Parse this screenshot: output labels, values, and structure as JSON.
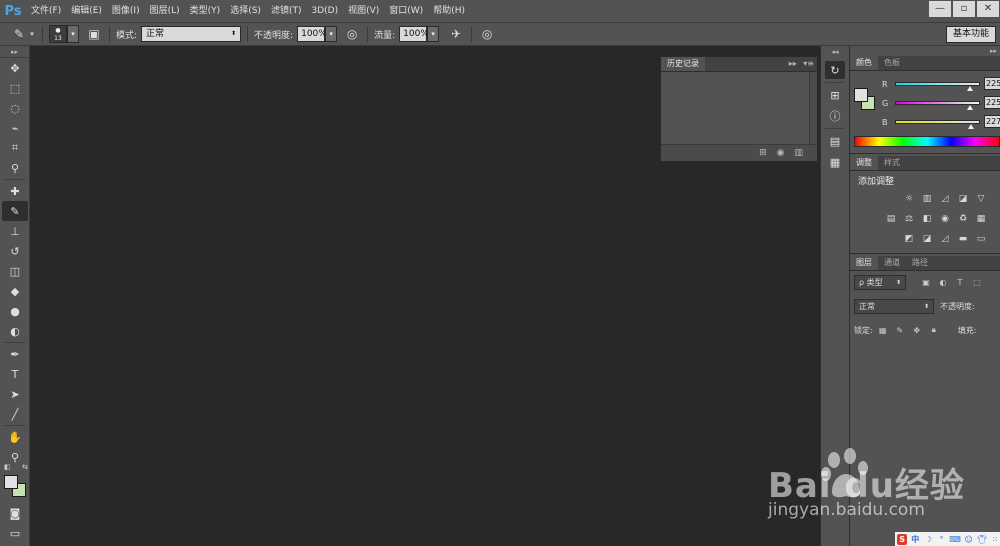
{
  "app": {
    "logo": "Ps",
    "menu": [
      "文件(F)",
      "编辑(E)",
      "图像(I)",
      "图层(L)",
      "类型(Y)",
      "选择(S)",
      "滤镜(T)",
      "3D(D)",
      "视图(V)",
      "窗口(W)",
      "帮助(H)"
    ],
    "window_controls": [
      "—",
      "▫",
      "✕"
    ]
  },
  "options": {
    "brush_size": "13",
    "mode_label": "模式:",
    "mode_value": "正常",
    "opacity_label": "不透明度:",
    "opacity_value": "100%",
    "flow_label": "流量:",
    "flow_value": "100%",
    "workspace": "基本功能"
  },
  "history_panel": {
    "tab": "历史记录",
    "collapse": "▸▸",
    "menu": "▾≡"
  },
  "color_panel": {
    "tabs": [
      "颜色",
      "色板"
    ],
    "channels": [
      {
        "label": "R",
        "value": "225",
        "fraction": 0.88,
        "gradient": "linear-gradient(to right,#00e3e3,#ffe3e3)"
      },
      {
        "label": "G",
        "value": "225",
        "fraction": 0.88,
        "gradient": "linear-gradient(to right,#e100e3,#e1ffe3)"
      },
      {
        "label": "B",
        "value": "227",
        "fraction": 0.89,
        "gradient": "linear-gradient(to right,#e1e100,#e1e1ff)"
      }
    ],
    "foreground": "#e1e1e3",
    "background": "#c6e2b0"
  },
  "adjust_panel": {
    "tabs": [
      "调整",
      "样式"
    ],
    "title": "添加调整"
  },
  "layers_panel": {
    "tabs": [
      "图层",
      "通道",
      "路径"
    ],
    "filter_value": "ρ 类型",
    "blend_mode": "正常",
    "opacity_label": "不透明度:",
    "lock_label": "锁定:",
    "fill_label": "填充:"
  },
  "watermark": {
    "brand": "Bai  du经验",
    "url": "jingyan.baidu.com"
  },
  "ime": {
    "logo": "S",
    "lang": "中"
  }
}
